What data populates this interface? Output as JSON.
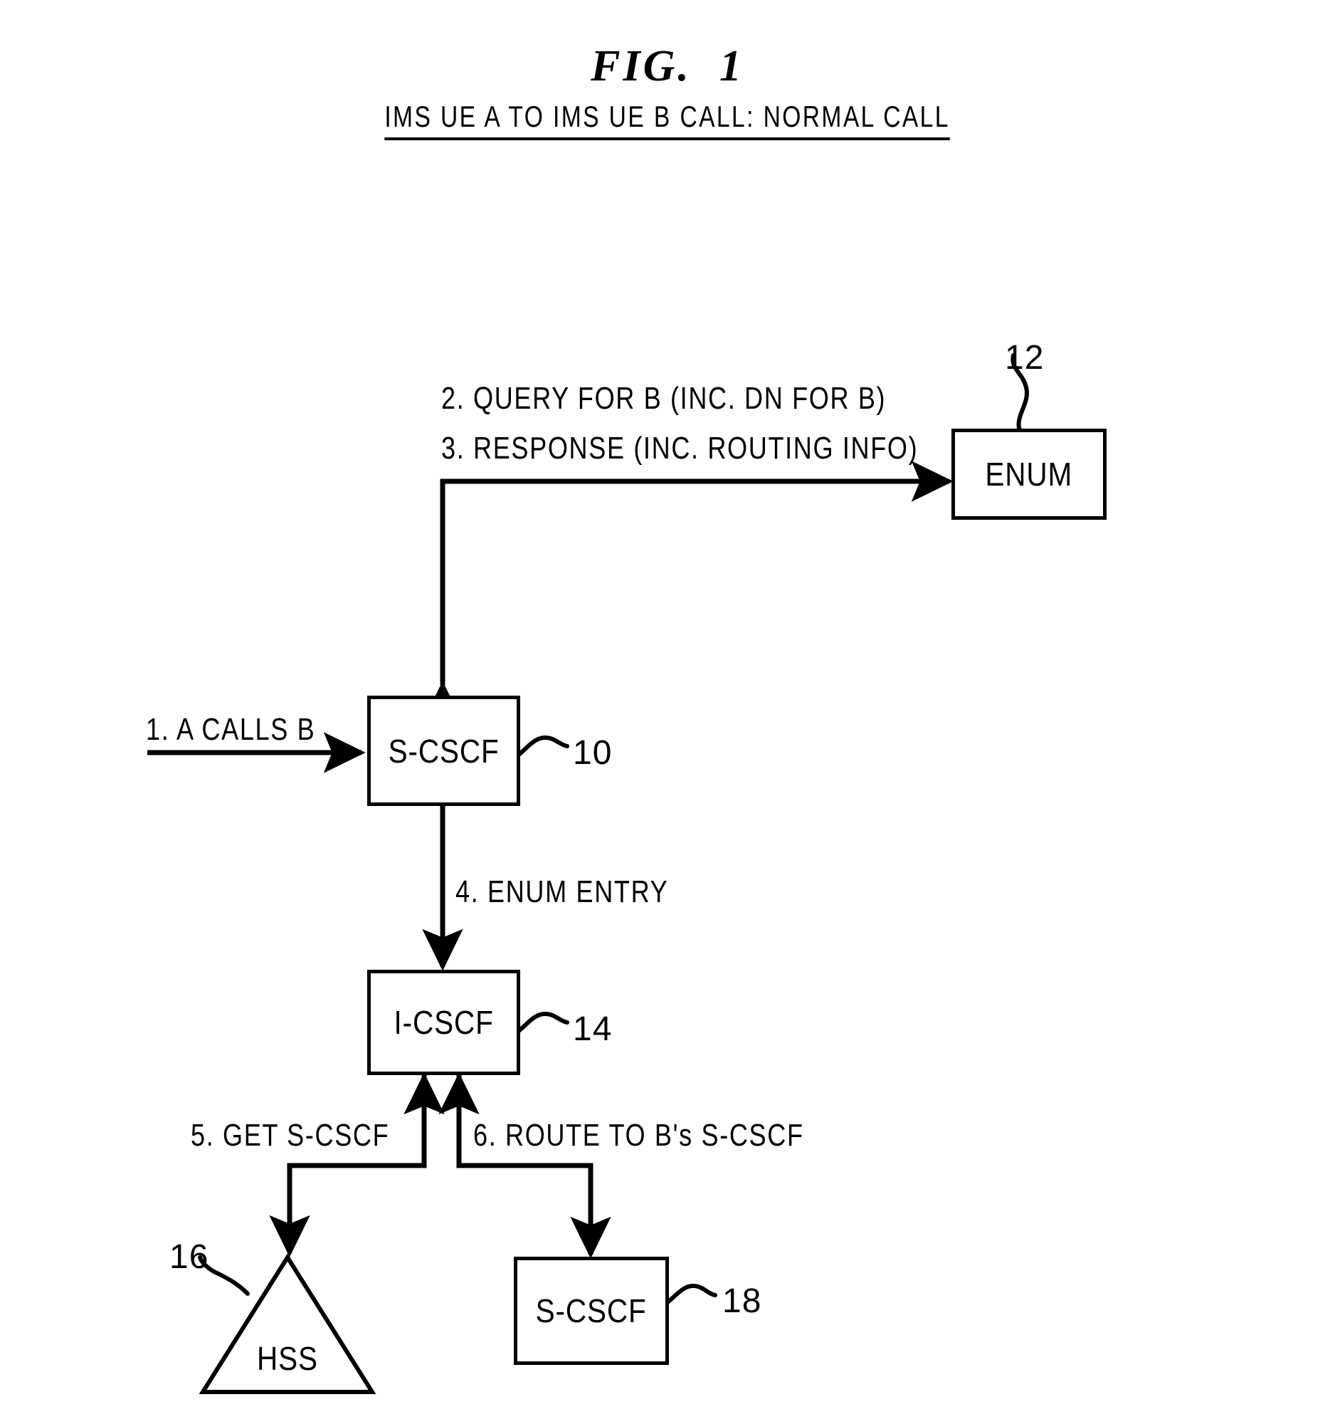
{
  "figure": {
    "title": "FIG.  1",
    "subtitle": "IMS UE A TO IMS UE B CALL: NORMAL CALL"
  },
  "nodes": [
    {
      "id": "enum",
      "label": "ENUM",
      "shape": "box",
      "ref": "12"
    },
    {
      "id": "s-cscf-origin",
      "label": "S-CSCF",
      "shape": "box",
      "ref": "10"
    },
    {
      "id": "i-cscf",
      "label": "I-CSCF",
      "shape": "box",
      "ref": "14"
    },
    {
      "id": "hss",
      "label": "HSS",
      "shape": "triangle",
      "ref": "16"
    },
    {
      "id": "s-cscf-term",
      "label": "S-CSCF",
      "shape": "box",
      "ref": "18"
    }
  ],
  "messages": [
    {
      "num": "1",
      "text": "1. A CALLS B"
    },
    {
      "num": "2",
      "text": "2. QUERY FOR B (INC. DN FOR B)"
    },
    {
      "num": "3",
      "text": "3. RESPONSE (INC. ROUTING INFO)"
    },
    {
      "num": "4",
      "text": "4. ENUM ENTRY"
    },
    {
      "num": "5",
      "text": "5. GET S-CSCF"
    },
    {
      "num": "6",
      "text": "6. ROUTE TO B's S-CSCF"
    }
  ],
  "refs": {
    "enum": "12",
    "s_cscf_origin": "10",
    "i_cscf": "14",
    "hss": "16",
    "s_cscf_term": "18"
  },
  "colors": {
    "ink": "#000000",
    "paper": "#ffffff"
  }
}
